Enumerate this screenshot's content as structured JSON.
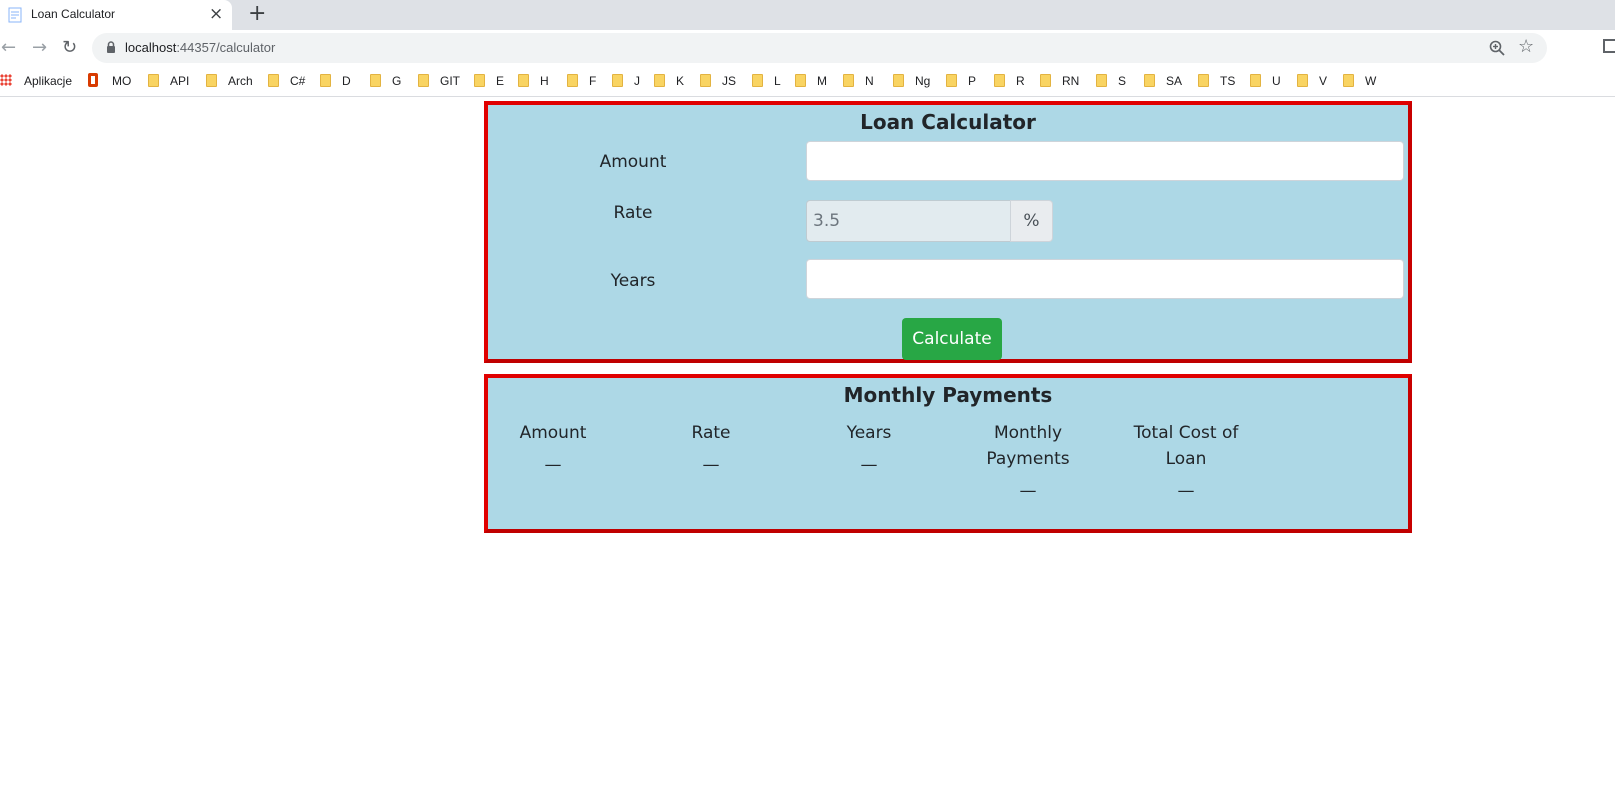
{
  "browser": {
    "tab_title": "Loan Calculator",
    "tab_close": "×",
    "new_tab": "+",
    "url_host": "localhost",
    "url_path": ":44357/calculator",
    "nav": {
      "back": "←",
      "forward": "→",
      "reload": "↻",
      "star": "☆"
    },
    "icons": [
      "page-icon",
      "lock-icon",
      "zoom-icon",
      "star-icon",
      "extension-icon"
    ]
  },
  "bookmarks": [
    "Aplikacje",
    "MO",
    "API",
    "Arch",
    "C#",
    "D",
    "G",
    "GIT",
    "E",
    "H",
    "F",
    "J",
    "K",
    "JS",
    "L",
    "M",
    "N",
    "Ng",
    "P",
    "R",
    "RN",
    "S",
    "SA",
    "TS",
    "U",
    "V",
    "W"
  ],
  "calculator": {
    "title": "Loan Calculator",
    "amount_label": "Amount",
    "amount_value": "",
    "rate_label": "Rate",
    "rate_value": "3.5",
    "rate_suffix": "%",
    "years_label": "Years",
    "years_value": "",
    "calculate_label": "Calculate"
  },
  "payments": {
    "title": "Monthly Payments",
    "columns": [
      {
        "header": "Amount",
        "value": "—"
      },
      {
        "header": "Rate",
        "value": "—"
      },
      {
        "header": "Years",
        "value": "—"
      },
      {
        "header": "Monthly Payments",
        "value": "—"
      },
      {
        "header": "Total Cost of Loan",
        "value": "—"
      }
    ]
  },
  "colors": {
    "card_bg": "#add8e6",
    "card_border": "#e00000",
    "button_bg": "#28a745"
  }
}
